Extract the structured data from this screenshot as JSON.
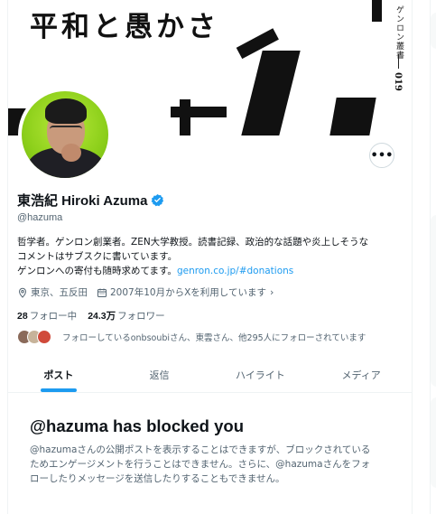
{
  "banner": {
    "title": "平和と愚かさ",
    "series_label": "ゲンロン叢書",
    "series_number": "019"
  },
  "profile": {
    "display_name": "東浩紀 Hiroki Azuma",
    "handle": "@hazuma",
    "verified_icon": "verified-badge-icon",
    "bio_lines": [
      "哲学者。ゲンロン創業者。ZEN大学教授。読書記録、政治的な話題や炎上しそうな",
      "コメントはサブスクに書いています。"
    ],
    "bio_donation_prefix": "ゲンロンへの寄付も随時求めてます。",
    "bio_link": "genron.co.jp/#donations",
    "location": "東京、五反田",
    "joined": "2007年10月からXを利用しています",
    "following_count": "28",
    "following_label": "フォロー中",
    "followers_count": "24.3万",
    "followers_label": "フォロワー",
    "known_followers": "フォローしているonbsoubiさん、東雲さん、他295人にフォローされています",
    "more_label": "•••"
  },
  "tabs": [
    {
      "label": "ポスト",
      "active": true
    },
    {
      "label": "返信",
      "active": false
    },
    {
      "label": "ハイライト",
      "active": false
    },
    {
      "label": "メディア",
      "active": false
    }
  ],
  "blocked": {
    "title": "@hazuma has blocked you",
    "body_lines": [
      "@hazumaさんの公開ポストを表示することはできますが、ブロックされている",
      "ためエンゲージメントを行うことはできません。さらに、@hazumaさんをフォ",
      "ローしたりメッセージを送信したりすることもできません。"
    ]
  },
  "colors": {
    "accent": "#1d9bf0",
    "text_primary": "#0f1419",
    "text_secondary": "#536471",
    "avatar_bg": "#8ccf1a"
  }
}
